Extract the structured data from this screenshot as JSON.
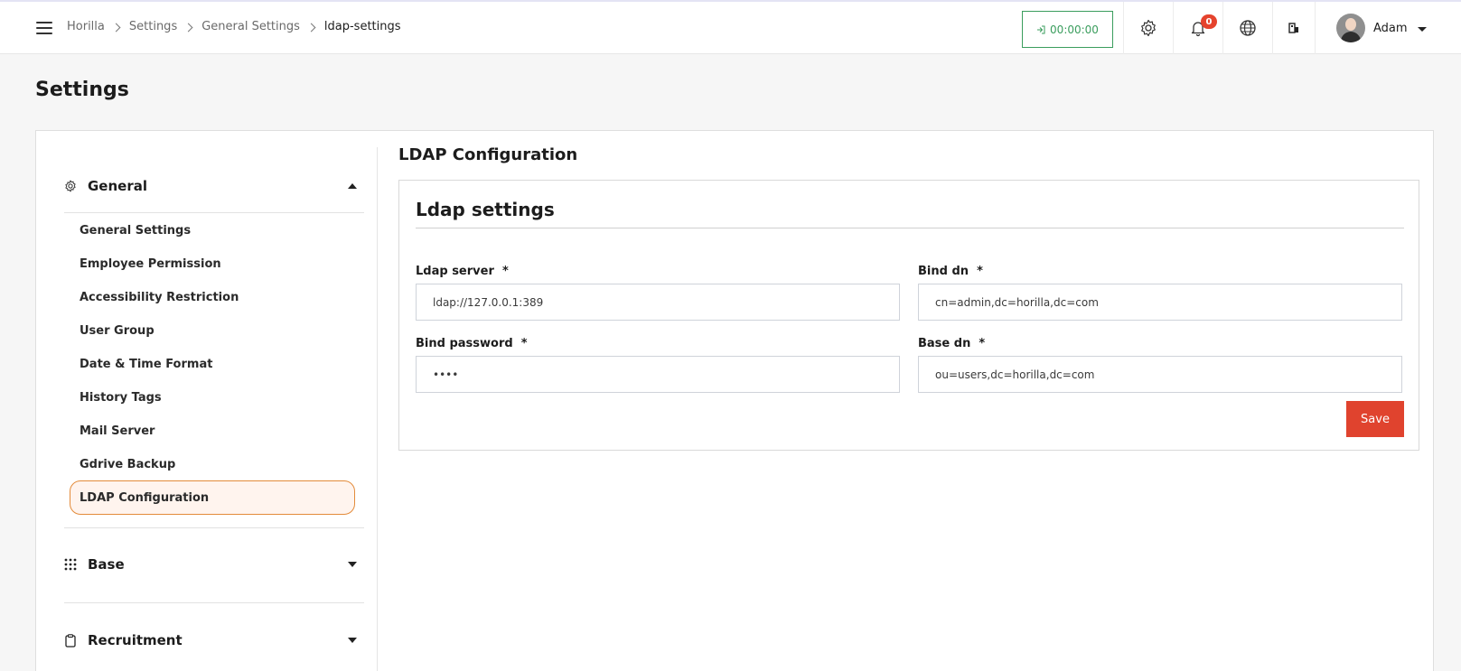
{
  "breadcrumb": [
    "Horilla",
    "Settings",
    "General Settings",
    "ldap-settings"
  ],
  "header": {
    "timer": "00:00:00",
    "notification_count": "0",
    "user_name": "Adam"
  },
  "page_title": "Settings",
  "sidebar": {
    "groups": [
      {
        "label": "General",
        "expanded": true,
        "icon": "gear-icon"
      },
      {
        "label": "Base",
        "expanded": false,
        "icon": "grid-icon"
      },
      {
        "label": "Recruitment",
        "expanded": false,
        "icon": "clipboard-icon"
      }
    ],
    "items": [
      {
        "label": "General Settings"
      },
      {
        "label": "Employee Permission"
      },
      {
        "label": "Accessibility Restriction"
      },
      {
        "label": "User Group"
      },
      {
        "label": "Date & Time Format"
      },
      {
        "label": "History Tags"
      },
      {
        "label": "Mail Server"
      },
      {
        "label": "Gdrive Backup"
      },
      {
        "label": "LDAP Configuration",
        "active": true
      }
    ]
  },
  "main": {
    "section_title": "LDAP Configuration",
    "card_title": "Ldap settings",
    "fields": {
      "ldap_server": {
        "label": "Ldap server",
        "value": "ldap://127.0.0.1:389"
      },
      "bind_dn": {
        "label": "Bind dn",
        "value": "cn=admin,dc=horilla,dc=com"
      },
      "bind_password": {
        "label": "Bind password",
        "value": "••••"
      },
      "base_dn": {
        "label": "Base dn",
        "value": "ou=users,dc=horilla,dc=com"
      }
    },
    "required_marker": "*",
    "save_label": "Save"
  },
  "colors": {
    "accent": "#e0432e",
    "timer_green": "#3a9d5d",
    "active_border": "#e38b3a"
  }
}
